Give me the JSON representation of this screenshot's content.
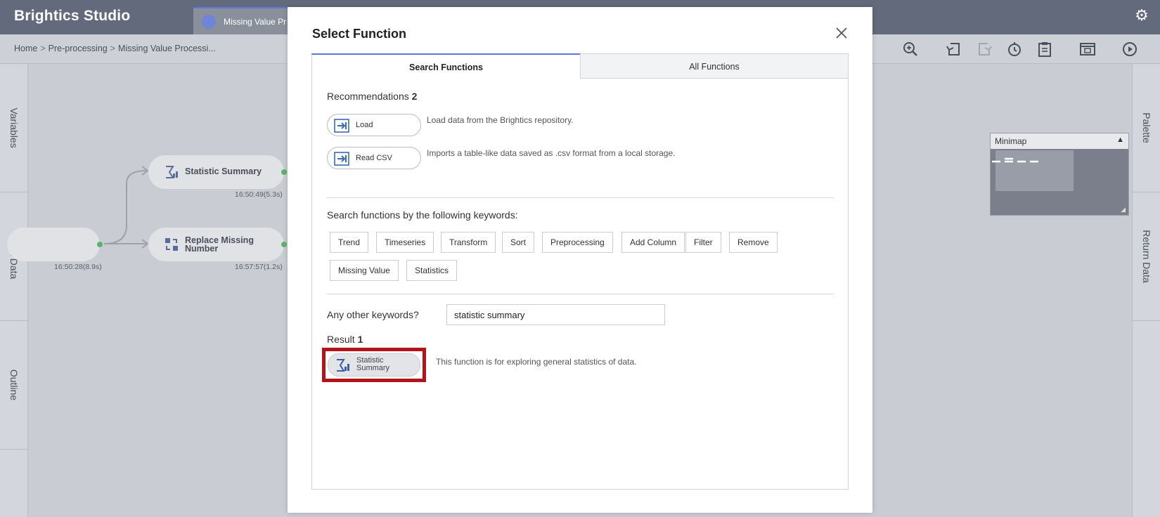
{
  "app": {
    "title": "Brightics Studio"
  },
  "tab": {
    "label": "Missing Value Pr"
  },
  "breadcrumb": {
    "items": [
      "Home",
      "Pre-processing",
      "Missing Value Processi..."
    ]
  },
  "left_panel": {
    "tabs": [
      "Variables",
      "Input Data",
      "Outline"
    ]
  },
  "right_panel": {
    "tabs": [
      "Palette",
      "Return Data"
    ]
  },
  "canvas": {
    "nodes": [
      {
        "label": "Statistic Summary",
        "time": "16:50:49(5.3s)"
      },
      {
        "label": "Replace Missing Number",
        "time": "16:57:57(1.2s)"
      },
      {
        "label": "",
        "time": "16:50:28(8.9s)"
      }
    ],
    "minimap": {
      "title": "Minimap"
    }
  },
  "modal": {
    "title": "Select Function",
    "tabs": {
      "active": "Search Functions",
      "inactive": "All Functions"
    },
    "recommendations": {
      "label": "Recommendations",
      "count": "2",
      "items": [
        {
          "name": "Load",
          "description": "Load data from the Brightics repository."
        },
        {
          "name": "Read CSV",
          "description": "Imports a table-like data saved as .csv format from a local storage."
        }
      ]
    },
    "keywords": {
      "label": "Search functions by the following keywords:",
      "items": [
        "Trend",
        "Timeseries",
        "Transform",
        "Sort",
        "Preprocessing",
        "Add Column",
        "Filter",
        "Remove",
        "Missing Value",
        "Statistics"
      ]
    },
    "other": {
      "label": "Any other keywords?",
      "value": "statistic summary"
    },
    "result": {
      "label": "Result",
      "count": "1",
      "items": [
        {
          "name_line1": "Statistic",
          "name_line2": "Summary",
          "description": "This function is for exploring general statistics of data."
        }
      ]
    }
  },
  "colors": {
    "topbar": "#636a7b",
    "accent": "#5a78d8",
    "highlight": "#b3141c",
    "connector_dot": "#5cb270"
  },
  "icons": [
    "settings-gear-icon",
    "close-icon",
    "load-icon",
    "read-csv-icon",
    "sigma-icon",
    "replace-icon",
    "zoom-in-icon",
    "undo-icon",
    "redo-icon",
    "history-icon",
    "clipboard-icon",
    "layout-icon",
    "run-icon",
    "chevron-up-icon"
  ]
}
